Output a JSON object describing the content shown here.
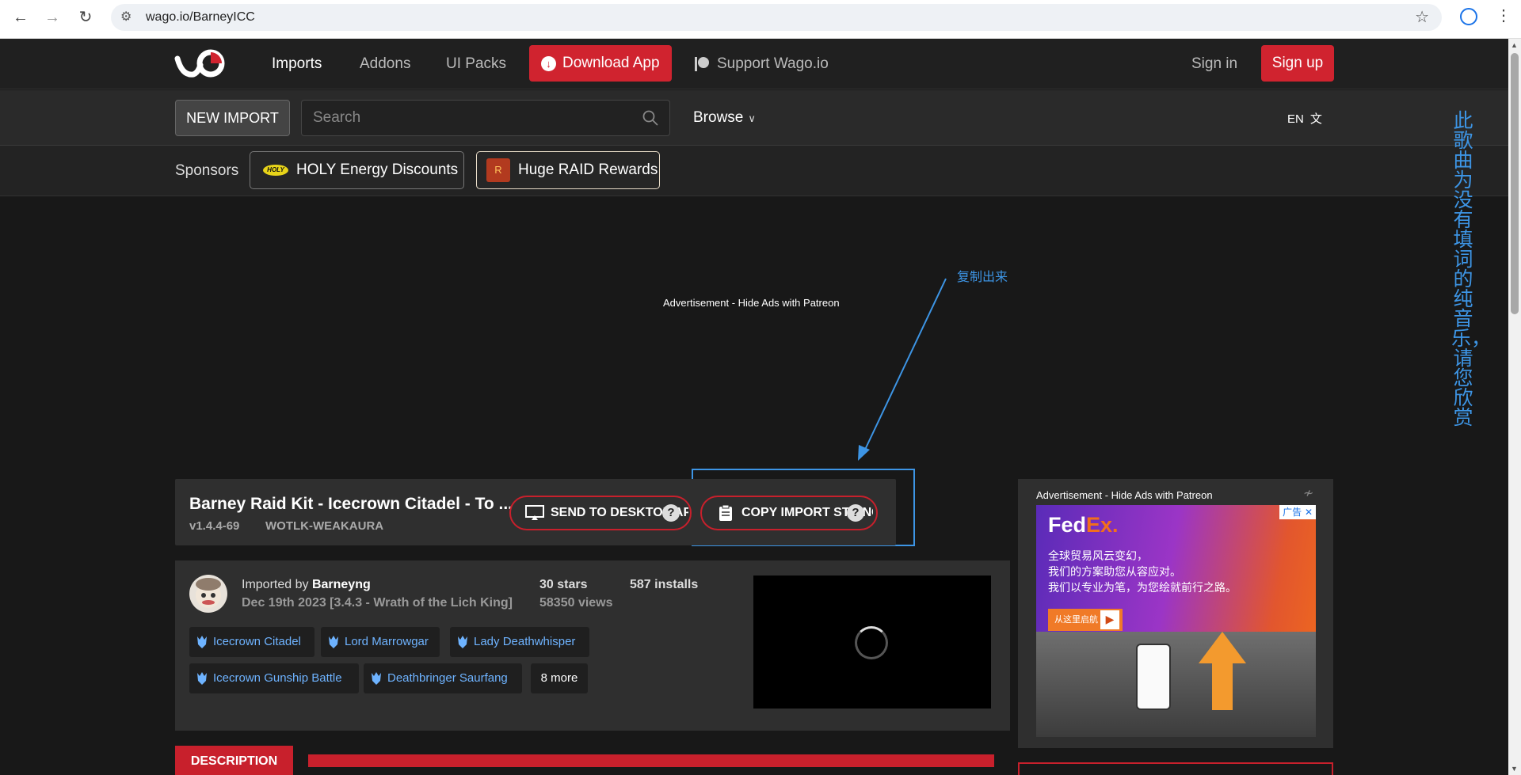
{
  "browser": {
    "url": "wago.io/BarneyICC",
    "back_icon": "←",
    "forward_icon": "→",
    "reload_icon": "↻",
    "star_icon": "☆"
  },
  "nav": {
    "items": [
      "Imports",
      "Addons",
      "UI Packs"
    ],
    "download_app": "Download App",
    "support": "Support Wago.io",
    "sign_in": "Sign in",
    "sign_up": "Sign up"
  },
  "subnav": {
    "new_import": "NEW IMPORT",
    "search_placeholder": "Search",
    "browse": "Browse",
    "lang": "EN"
  },
  "sponsors": {
    "label": "Sponsors",
    "items": [
      {
        "label": "HOLY Energy Discounts",
        "logo_text": "HOLY"
      },
      {
        "label": "Huge RAID Rewards",
        "logo_text": "R"
      }
    ]
  },
  "ads": {
    "top_label": "Advertisement - Hide Ads with Patreon",
    "side_label": "Advertisement - Hide Ads with Patreon",
    "fedex": {
      "brand_fed": "Fed",
      "brand_ex": "Ex.",
      "lines": [
        "全球贸易风云变幻，",
        "我们的方案助您从容应对。",
        "我们以专业为笔，为您绘就前行之路。"
      ],
      "cta": "从这里启航",
      "adchoice": "广告",
      "close": "✕"
    }
  },
  "annotation": {
    "note": "复制出来",
    "vertical": "此歌曲为没有填词的纯音乐，请您欣赏",
    "color": "#3d95e5"
  },
  "import": {
    "title": "Barney Raid Kit - Icecrown Citadel - To ...",
    "version": "v1.4.4-69",
    "type": "WOTLK-WEAKAURA",
    "send_to_desktop": "SEND TO DESKTOP APP",
    "copy_import_string": "COPY IMPORT STRING",
    "help": "?",
    "imported_by_label": "Imported by",
    "author": "Barneyng",
    "date": "Dec 19th 2023 [3.4.3 - Wrath of the Lich King]",
    "stars": "30 stars",
    "installs": "587 installs",
    "views": "58350 views",
    "tags": [
      "Icecrown Citadel",
      "Lord Marrowgar",
      "Lady Deathwhisper",
      "Icecrown Gunship Battle",
      "Deathbringer Saurfang"
    ],
    "more": "8 more",
    "description_tab": "DESCRIPTION"
  },
  "colors": {
    "accent": "#d0232f",
    "tag_text": "#6eb3ff"
  }
}
